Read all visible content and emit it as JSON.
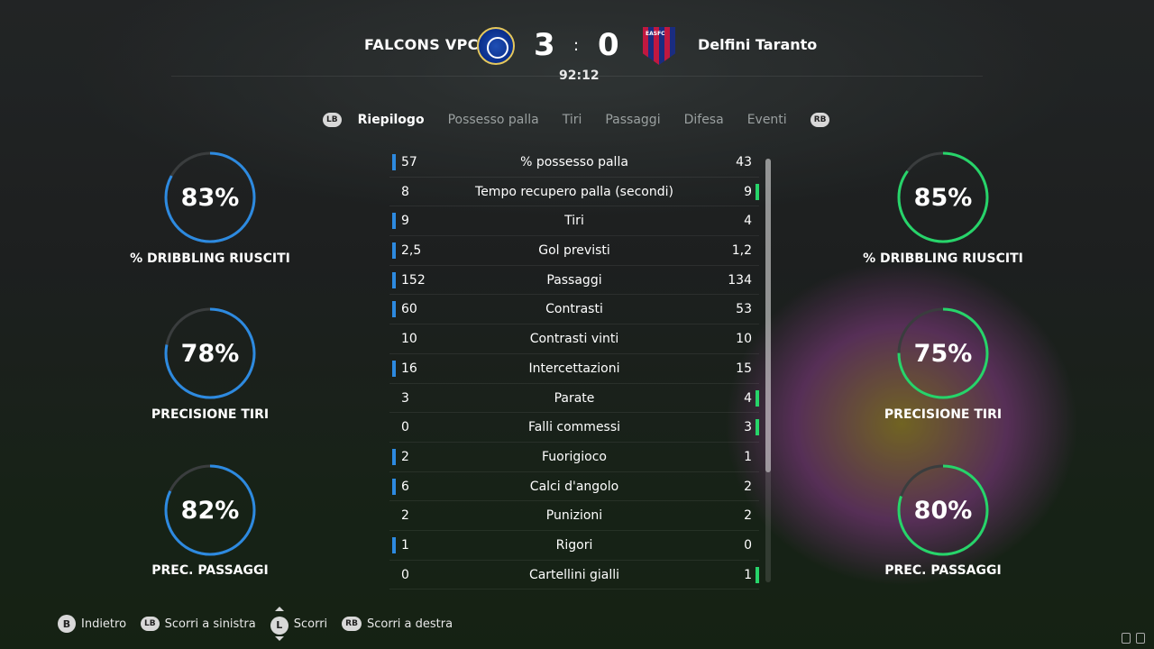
{
  "match": {
    "home_team": "FALCONS VPC",
    "away_team": "Delfini Taranto",
    "home_score": "3",
    "separator": ":",
    "away_score": "0",
    "clock": "92:12",
    "away_badge_text": "EASFC"
  },
  "tabs": {
    "lb": "LB",
    "rb": "RB",
    "items": [
      "Riepilogo",
      "Possesso palla",
      "Tiri",
      "Passaggi",
      "Difesa",
      "Eventi"
    ],
    "active": "Riepilogo"
  },
  "home_rings": [
    {
      "value": "83%",
      "label": "% DRIBBLING RIUSCITI",
      "fraction": 0.83
    },
    {
      "value": "78%",
      "label": "PRECISIONE TIRI",
      "fraction": 0.78
    },
    {
      "value": "82%",
      "label": "PREC. PASSAGGI",
      "fraction": 0.82
    }
  ],
  "away_rings": [
    {
      "value": "85%",
      "label": "% DRIBBLING RIUSCITI",
      "fraction": 0.85
    },
    {
      "value": "75%",
      "label": "PRECISIONE TIRI",
      "fraction": 0.75
    },
    {
      "value": "80%",
      "label": "PREC. PASSAGGI",
      "fraction": 0.8
    }
  ],
  "stats": [
    {
      "home": "57",
      "name": "% possesso palla",
      "away": "43",
      "leader": "home"
    },
    {
      "home": "8",
      "name": "Tempo recupero palla (secondi)",
      "away": "9",
      "leader": "away"
    },
    {
      "home": "9",
      "name": "Tiri",
      "away": "4",
      "leader": "home"
    },
    {
      "home": "2,5",
      "name": "Gol previsti",
      "away": "1,2",
      "leader": "home"
    },
    {
      "home": "152",
      "name": "Passaggi",
      "away": "134",
      "leader": "home"
    },
    {
      "home": "60",
      "name": "Contrasti",
      "away": "53",
      "leader": "home"
    },
    {
      "home": "10",
      "name": "Contrasti vinti",
      "away": "10",
      "leader": "none"
    },
    {
      "home": "16",
      "name": "Intercettazioni",
      "away": "15",
      "leader": "home"
    },
    {
      "home": "3",
      "name": "Parate",
      "away": "4",
      "leader": "away"
    },
    {
      "home": "0",
      "name": "Falli commessi",
      "away": "3",
      "leader": "away"
    },
    {
      "home": "2",
      "name": "Fuorigioco",
      "away": "1",
      "leader": "home"
    },
    {
      "home": "6",
      "name": "Calci d'angolo",
      "away": "2",
      "leader": "home"
    },
    {
      "home": "2",
      "name": "Punizioni",
      "away": "2",
      "leader": "none"
    },
    {
      "home": "1",
      "name": "Rigori",
      "away": "0",
      "leader": "home"
    },
    {
      "home": "0",
      "name": "Cartellini gialli",
      "away": "1",
      "leader": "away"
    }
  ],
  "footer": {
    "back_button": "B",
    "back_label": "Indietro",
    "lb_button": "LB",
    "lb_label": "Scorri a sinistra",
    "l_button": "L",
    "l_label": "Scorri",
    "rb_button": "RB",
    "rb_label": "Scorri a destra"
  },
  "colors": {
    "home_accent": "#2d8ae0",
    "away_accent": "#27d46a",
    "ring_track": "#3a3d3e"
  }
}
